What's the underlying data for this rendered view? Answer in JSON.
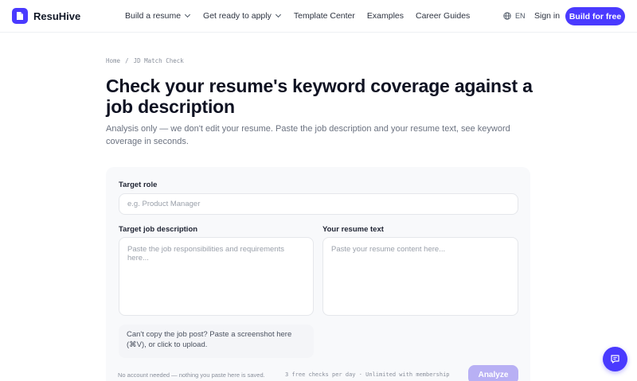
{
  "brand": {
    "name": "ResuHive",
    "accent": "#4a3aff"
  },
  "nav": {
    "links": [
      {
        "label": "Build a resume",
        "has_menu": true
      },
      {
        "label": "Get ready to apply",
        "has_menu": true
      },
      {
        "label": "Template Center",
        "has_menu": false
      },
      {
        "label": "Examples",
        "has_menu": false
      },
      {
        "label": "Career Guides",
        "has_menu": false
      }
    ],
    "language": "EN",
    "signin_label": "Sign in",
    "cta_label": "Build for free"
  },
  "breadcrumb": {
    "home": "Home",
    "separator": "/",
    "current": "JD Match Check"
  },
  "page": {
    "title": "Check your resume's keyword coverage against a job description",
    "subtitle": "Analysis only — we don't edit your resume. Paste the job description and your resume text, see keyword coverage in seconds."
  },
  "form": {
    "target_role": {
      "label": "Target role",
      "placeholder": "e.g. Product Manager",
      "value": ""
    },
    "job_description": {
      "label": "Target job description",
      "placeholder": "Paste the job responsibilities and requirements here...",
      "value": ""
    },
    "resume_text": {
      "label": "Your resume text",
      "placeholder": "Paste your resume content here...",
      "value": ""
    },
    "upload_hint": "Can't copy the job post? Paste a screenshot here (⌘V), or click to upload.",
    "footer_note": "No account needed — nothing you paste here is saved.",
    "quota_text": "3 free checks per day · Unlimited with membership",
    "analyze_label": "Analyze"
  },
  "icons": {
    "logo": "document-icon",
    "language": "globe-icon",
    "chat": "chat-bubble-icon"
  }
}
